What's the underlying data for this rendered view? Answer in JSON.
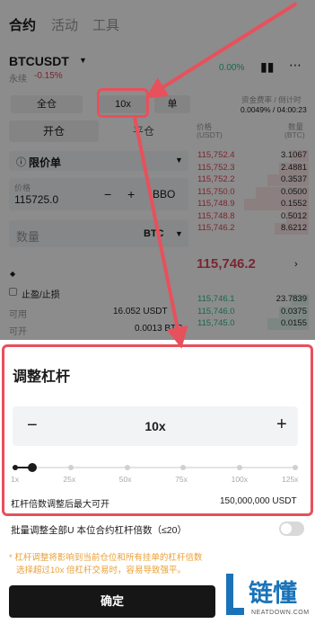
{
  "nav": {
    "tabs": [
      "合约",
      "活动",
      "工具"
    ]
  },
  "ticker": {
    "symbol": "BTCUSDT",
    "type": "永续",
    "change": "-0.15%",
    "funding_change": "0.00%"
  },
  "order": {
    "margin_mode": "全仓",
    "leverage": "10x",
    "position_mode": "单",
    "open_label": "开仓",
    "close_label": "平仓",
    "order_type": "限价单",
    "price_label": "价格",
    "price_value": "115725.0",
    "bbo": "BBO",
    "minus": "−",
    "plus": "+",
    "qty_label": "数量",
    "qty_unit": "BTC",
    "tpsl_label": "止盈/止损",
    "avail_label": "可用",
    "avail_value": "16.052 USDT",
    "open_max_label": "可开",
    "open_max_value": "0.0013 BTC"
  },
  "orderbook": {
    "funding_label": "资金费率 / 倒计时",
    "funding_value": "0.0049% / 04:00:23",
    "price_header": "价格",
    "price_unit": "(USDT)",
    "qty_header": "数量",
    "qty_unit": "(BTC)",
    "asks": [
      {
        "price": "115,752.4",
        "qty": "3.1067"
      },
      {
        "price": "115,752.3",
        "qty": "2.4881"
      },
      {
        "price": "115,752.2",
        "qty": "0.3537"
      },
      {
        "price": "115,750.0",
        "qty": "0.0500"
      },
      {
        "price": "115,748.9",
        "qty": "0.1552"
      },
      {
        "price": "115,748.8",
        "qty": "0.5012"
      },
      {
        "price": "115,746.2",
        "qty": "8.6212"
      }
    ],
    "mid_price": "115,746.2",
    "bids": [
      {
        "price": "115,746.1",
        "qty": "23.7839"
      },
      {
        "price": "115,746.0",
        "qty": "0.0375"
      },
      {
        "price": "115,745.0",
        "qty": "0.0155"
      }
    ]
  },
  "leverage_panel": {
    "title": "调整杠杆",
    "value": "10x",
    "minus": "−",
    "plus": "+",
    "ticks": [
      "1x",
      "25x",
      "50x",
      "75x",
      "100x",
      "125x"
    ],
    "max_label": "杠杆倍数调整后最大可开",
    "max_value": "150,000,000 USDT",
    "batch_label": "批量调整全部U 本位合约杠杆倍数（≤20）",
    "warning_line1": "* 杠杆调整将影响到当前仓位和所有挂单的杠杆倍数",
    "warning_line2": "选择超过10x 倍杠杆交易时，容易导致强平。",
    "confirm_label": "确定",
    "slider_fraction": 0.07
  },
  "watermark": {
    "text": "链懂",
    "sub": "NEATDOWN.COM"
  },
  "colors": {
    "accent_red": "#e8505b",
    "down": "#e0465a",
    "up": "#2ebd85"
  }
}
